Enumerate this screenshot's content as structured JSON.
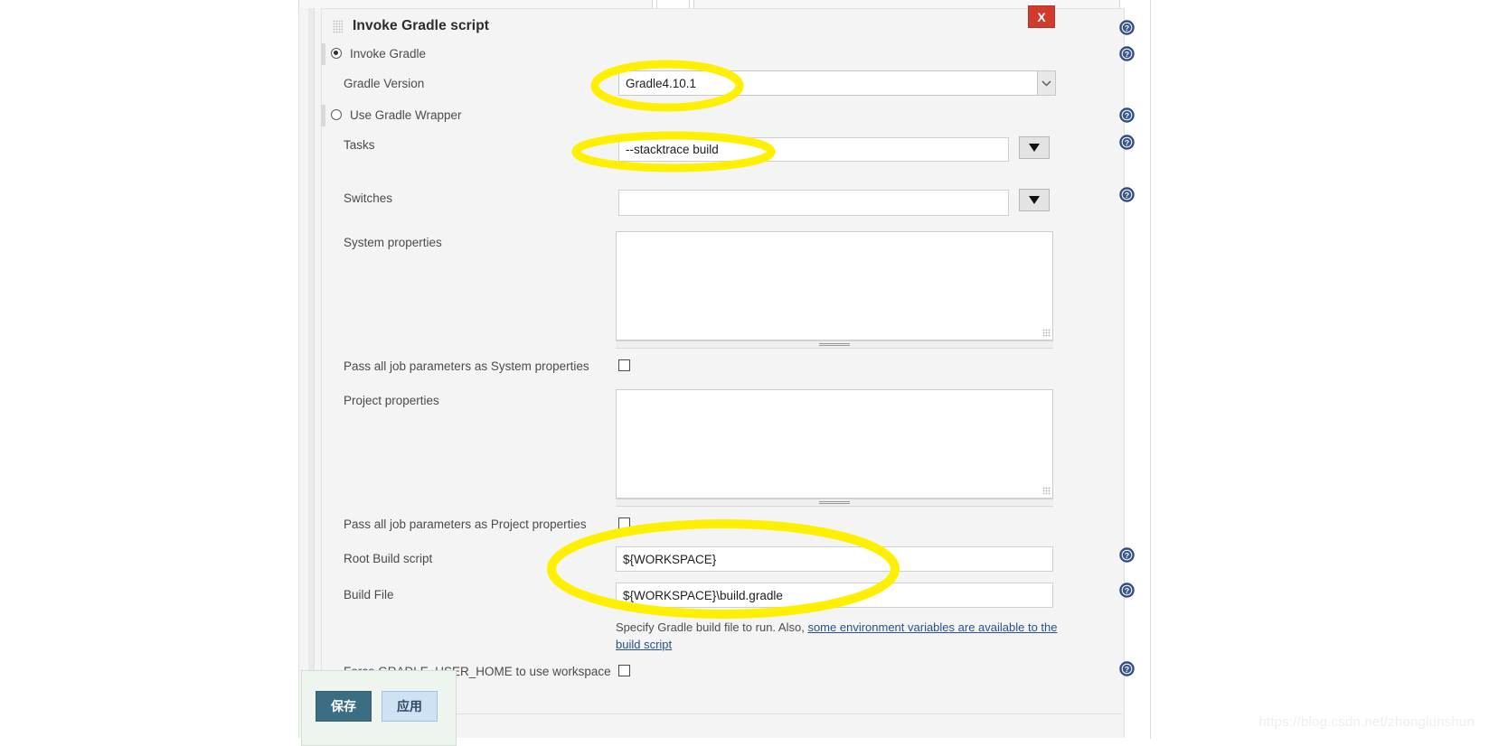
{
  "window": {
    "title": "Invoke Gradle script",
    "close_label": "X",
    "grip_icon": "drag-handle-icon"
  },
  "radios": [
    {
      "label": "Invoke Gradle",
      "checked": true
    },
    {
      "label": "Use Gradle Wrapper",
      "checked": false
    }
  ],
  "fields": {
    "gradle_version": {
      "label": "Gradle Version",
      "value": "Gradle4.10.1",
      "control": "combo",
      "arrow_icon": "chevron-down-icon"
    },
    "tasks": {
      "label": "Tasks",
      "value": "--stacktrace build",
      "placeholder": "",
      "dropdown_icon": "triangle-down-icon"
    },
    "switches": {
      "label": "Switches",
      "value": "",
      "placeholder": "",
      "dropdown_icon": "triangle-down-icon"
    },
    "system_properties": {
      "label": "System properties",
      "value": "",
      "placeholder": ""
    },
    "pass_system": {
      "label": "Pass all job parameters as System properties",
      "checked": false
    },
    "project_properties": {
      "label": "Project properties",
      "value": "",
      "placeholder": ""
    },
    "pass_project": {
      "label": "Pass all job parameters as Project properties",
      "checked": false
    },
    "root_build_script": {
      "label": "Root Build script",
      "value": "${WORKSPACE}",
      "placeholder": ""
    },
    "build_file": {
      "label": "Build File",
      "value": "${WORKSPACE}\\build.gradle",
      "placeholder": "",
      "description_prefix": "Specify Gradle build file to run. Also, ",
      "description_link": "some environment variables are available to the build script"
    },
    "force_gradle_user_home": {
      "label": "Force GRADLE_USER_HOME to use workspace",
      "checked": false
    }
  },
  "help_icon_name": "help-question-icon",
  "actions": {
    "save_label": "保存",
    "apply_label": "应用"
  },
  "watermark": "https://blog.csdn.net/zhonglunshun",
  "colors": {
    "close_red": "#d03b2d",
    "help_blue": "#39598f",
    "annotation_yellow": "#ffef00",
    "link_blue": "#25518f",
    "save_teal": "#3b6e82",
    "apply_blue": "#cfe2f3"
  },
  "annotations": [
    {
      "target": "gradle-version-field",
      "shape": "ellipse"
    },
    {
      "target": "tasks-field",
      "shape": "ellipse"
    },
    {
      "target": "root-build-script-and-build-file",
      "shape": "ellipse"
    }
  ]
}
